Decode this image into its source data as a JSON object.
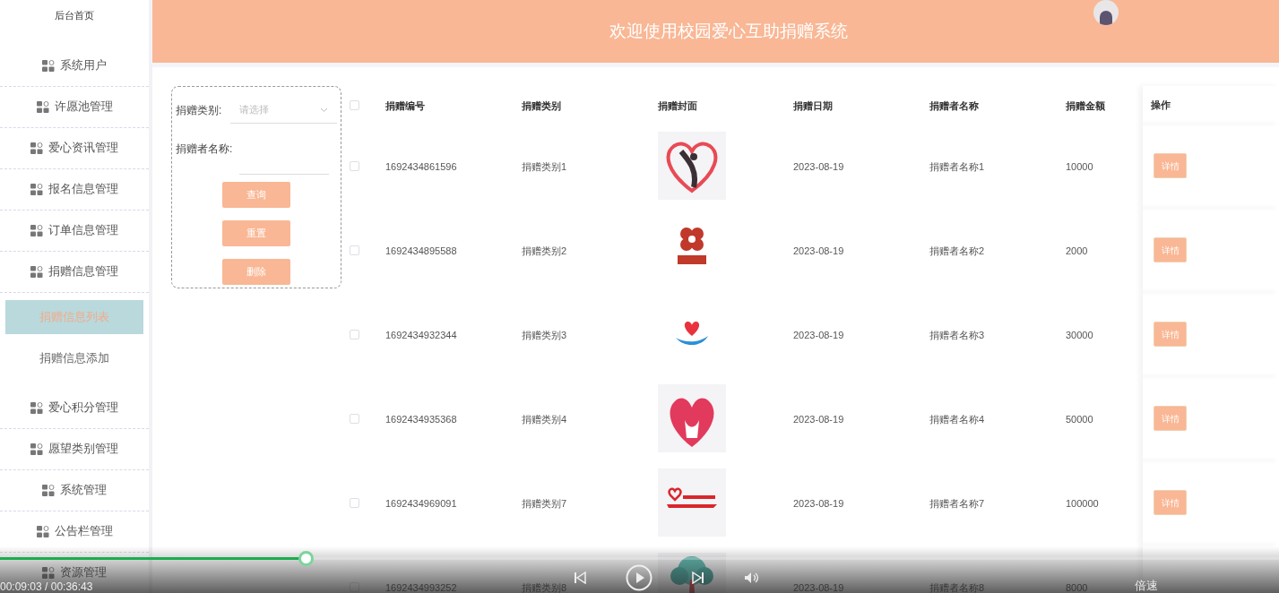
{
  "sidebar": {
    "items": [
      {
        "label": "后台首页",
        "kind": "link",
        "selected": false
      },
      {
        "label": "系统用户",
        "kind": "menu",
        "selected": false
      },
      {
        "label": "许愿池管理",
        "kind": "menu",
        "selected": false
      },
      {
        "label": "爱心资讯管理",
        "kind": "menu",
        "selected": false
      },
      {
        "label": "报名信息管理",
        "kind": "menu",
        "selected": false
      },
      {
        "label": "订单信息管理",
        "kind": "menu",
        "selected": false
      },
      {
        "label": "捐赠信息管理",
        "kind": "menu",
        "selected": false,
        "children": [
          {
            "label": "捐赠信息列表",
            "selected": true
          },
          {
            "label": "捐赠信息添加",
            "selected": false
          }
        ]
      },
      {
        "label": "爱心积分管理",
        "kind": "menu",
        "selected": false
      },
      {
        "label": "愿望类别管理",
        "kind": "menu",
        "selected": false
      },
      {
        "label": "系统管理",
        "kind": "menu",
        "selected": false
      },
      {
        "label": "公告栏管理",
        "kind": "menu",
        "selected": false
      },
      {
        "label": "资源管理",
        "kind": "menu",
        "selected": false
      }
    ]
  },
  "header": {
    "title": "欢迎使用校园爱心互助捐赠系统"
  },
  "filter": {
    "fields": [
      {
        "label": "捐赠类别:",
        "kind": "select",
        "placeholder": "请选择"
      },
      {
        "label": "捐赠者名称:",
        "kind": "text"
      }
    ],
    "buttons": [
      "查询",
      "重置",
      "删除"
    ]
  },
  "table": {
    "select_all": {
      "checked": false
    },
    "columns": [
      "捐赠编号",
      "捐赠类别",
      "捐赠封面",
      "捐赠日期",
      "捐赠者名称",
      "捐赠金额",
      "操作"
    ],
    "rows": [
      {
        "checked": false,
        "id": "1692434861596",
        "category": "捐赠类别1",
        "date": "2023-08-19",
        "donor": "捐赠者名称1",
        "amount": "10000",
        "action": "详情"
      },
      {
        "checked": false,
        "id": "1692434895588",
        "category": "捐赠类别2",
        "date": "2023-08-19",
        "donor": "捐赠者名称2",
        "amount": "2000",
        "action": "详情"
      },
      {
        "checked": false,
        "id": "1692434932344",
        "category": "捐赠类别3",
        "date": "2023-08-19",
        "donor": "捐赠者名称3",
        "amount": "30000",
        "action": "详情"
      },
      {
        "checked": false,
        "id": "1692434935368",
        "category": "捐赠类别4",
        "date": "2023-08-19",
        "donor": "捐赠者名称4",
        "amount": "50000",
        "action": "详情"
      },
      {
        "checked": false,
        "id": "1692434969091",
        "category": "捐赠类别7",
        "date": "2023-08-19",
        "donor": "捐赠者名称7",
        "amount": "100000",
        "action": "详情"
      },
      {
        "checked": false,
        "id": "1692434993252",
        "category": "捐赠类别8",
        "date": "2023-08-19",
        "donor": "捐赠者名称8",
        "amount": "8000"
      }
    ]
  },
  "player": {
    "progress": {
      "level": 0.239
    },
    "time": "00:09:03 / 00:36:43",
    "speed": "倍速"
  }
}
